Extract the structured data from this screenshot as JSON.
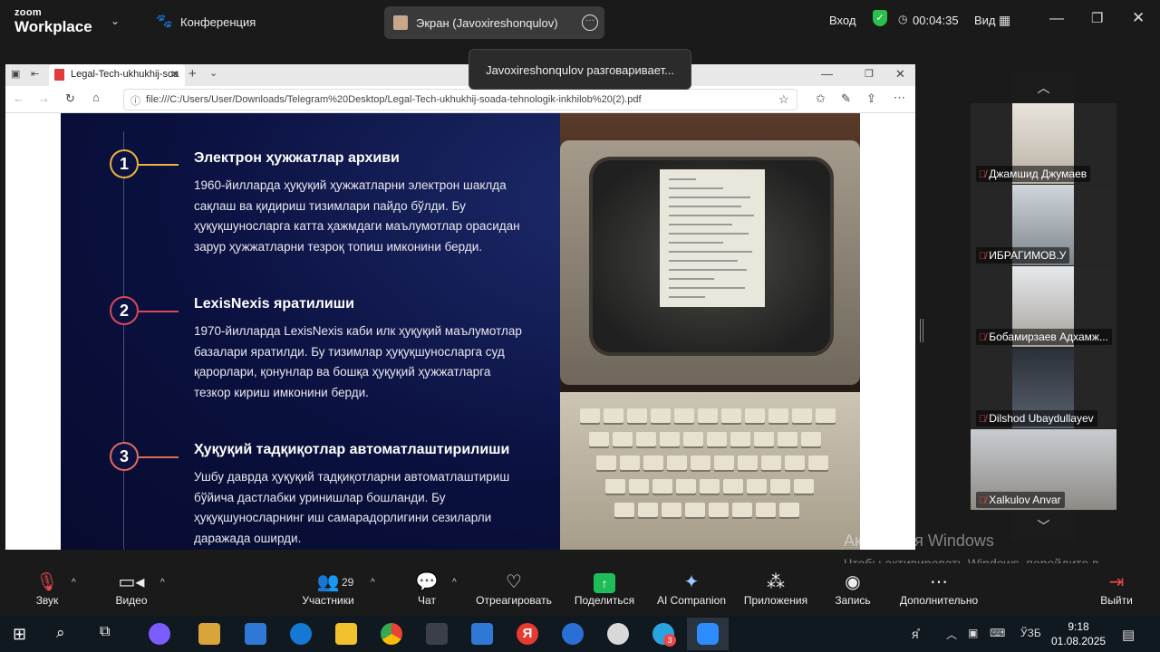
{
  "zoom": {
    "logo_top": "zoom",
    "logo_bottom": "Workplace",
    "conference_label": "Конференция",
    "screen_tab_label": "Экран (Javoxireshonqulov)",
    "enter_label": "Вход",
    "timer": "00:04:35",
    "view_label": "Вид",
    "tooltip": "Javoxireshonqulov разговаривает..."
  },
  "browser": {
    "tab_title": "Legal-Tech-ukhukhij-soa",
    "url": "file:///C:/Users/User/Downloads/Telegram%20Desktop/Legal-Tech-ukhukhij-soada-tehnologik-inkhilob%20(2).pdf"
  },
  "slide": {
    "sections": [
      {
        "num": "1",
        "title": "Электрон ҳужжатлар архиви",
        "body": "1960-йилларда ҳуқуқий ҳужжатларни электрон шаклда сақлаш ва қидириш тизимлари пайдо бўлди. Бу ҳуқуқшуносларга катта ҳажмдаги маълумотлар орасидан зарур ҳужжатларни тезроқ топиш имконини берди.",
        "color": "#e9b53c"
      },
      {
        "num": "2",
        "title": "LexisNexis яратилиши",
        "body": "1970-йилларда LexisNexis каби илк ҳуқуқий маълумотлар базалари яратилди. Бу тизимлар ҳуқуқшуносларга суд қарорлари, қонунлар ва бошқа ҳуқуқий ҳужжатларга тезкор кириш имконини берди.",
        "color": "#d9475a"
      },
      {
        "num": "3",
        "title": "Ҳуқуқий тадқиқотлар автоматлаштирилиши",
        "body": "Ушбу даврда ҳуқуқий тадқиқотларни автоматлаштириш бўйича дастлабки уринишлар бошланди. Бу ҳуқуқшуносларнинг иш самарадорлигини сезиларли даражада оширди.",
        "color": "#e06a5a"
      }
    ]
  },
  "participants": [
    {
      "name": "Джамшид Джумаев"
    },
    {
      "name": "ИБРАГИМОВ.У"
    },
    {
      "name": "Бобамирзаев Адхамж..."
    },
    {
      "name": "Dilshod Ubaydullayev"
    },
    {
      "name": "Xalkulov Anvar"
    }
  ],
  "watermark": {
    "title": "Активация Windows",
    "body": "Чтобы активировать Windows, перейдите в раздел \"Параметры\"."
  },
  "toolbar": {
    "audio": "Звук",
    "video": "Видео",
    "participants": "Участники",
    "participants_count": "29",
    "chat": "Чат",
    "react": "Отреагировать",
    "share": "Поделиться",
    "ai": "AI Companion",
    "apps": "Приложения",
    "record": "Запись",
    "more": "Дополнительно",
    "leave": "Выйти"
  },
  "taskbar": {
    "lang": "ЎЗБ",
    "time": "9:18",
    "date": "01.08.2025",
    "telegram_badge": "3"
  },
  "colors": {
    "zoom_bg": "#1a1a1a",
    "share_green": "#1fbd5a",
    "slide_bg": "#0b1140",
    "mic_off": "#e5484d"
  }
}
